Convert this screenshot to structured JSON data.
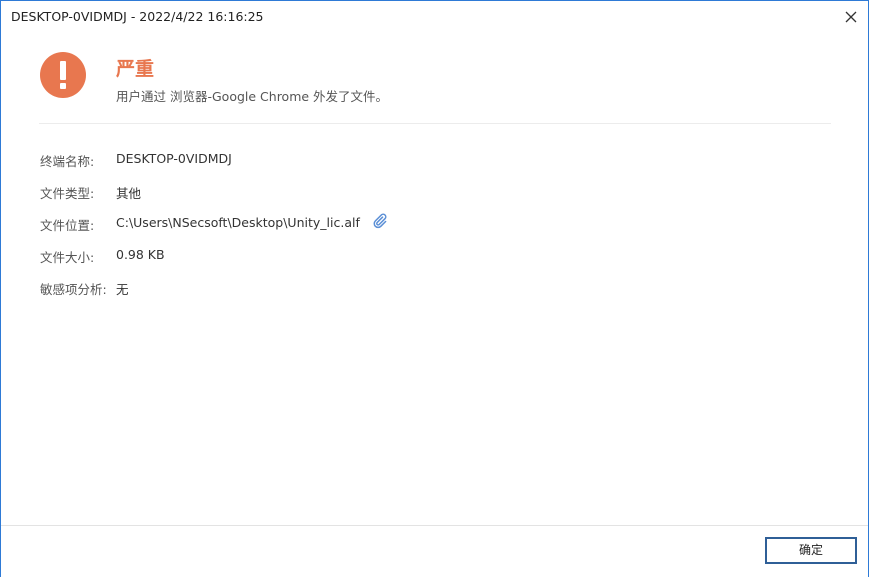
{
  "window": {
    "title": "DESKTOP-0VIDMDJ - 2022/4/22 16:16:25"
  },
  "alert": {
    "icon": "exclamation-circle-icon",
    "severity": "严重",
    "message": "用户通过 浏览器-Google Chrome 外发了文件。"
  },
  "details": [
    {
      "label": "终端名称:",
      "value": "DESKTOP-0VIDMDJ"
    },
    {
      "label": "文件类型:",
      "value": "其他"
    },
    {
      "label": "文件位置:",
      "value": "C:\\Users\\NSecsoft\\Desktop\\Unity_lic.alf",
      "icon": "paperclip-icon"
    },
    {
      "label": "文件大小:",
      "value": "0.98 KB"
    },
    {
      "label": "敏感项分析:",
      "value": "无"
    }
  ],
  "footer": {
    "ok_label": "确定"
  },
  "colors": {
    "severity": "#e8774f",
    "accent_border": "#2e7ad6",
    "attach_icon": "#5b8fd6",
    "button_border": "#2f5f97"
  }
}
